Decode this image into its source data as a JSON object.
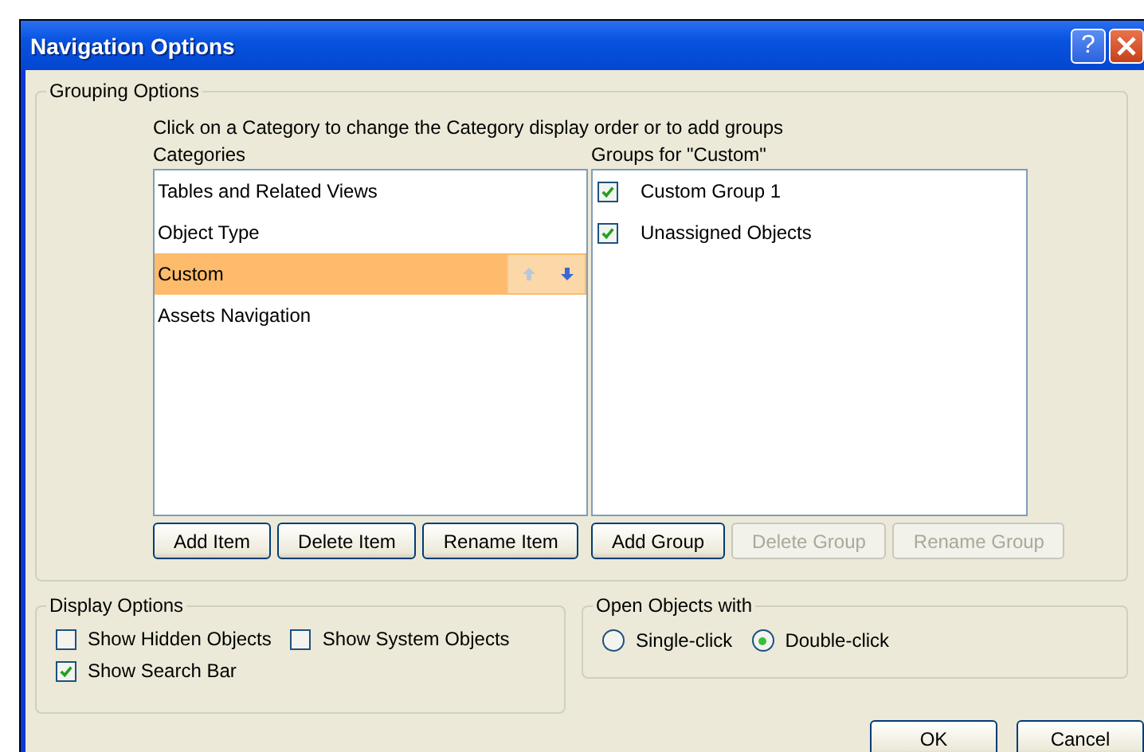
{
  "window": {
    "title": "Navigation Options",
    "help": "?"
  },
  "grouping_options": {
    "legend": "Grouping Options",
    "instruction": "Click on a Category to change the Category display order or to add groups",
    "categories_label": "Categories",
    "groups_label": "Groups for \"Custom\"",
    "categories": [
      {
        "label": "Tables and Related Views",
        "selected": false
      },
      {
        "label": "Object Type",
        "selected": false
      },
      {
        "label": "Custom",
        "selected": true
      },
      {
        "label": "Assets Navigation",
        "selected": false
      }
    ],
    "groups": [
      {
        "label": "Custom Group 1",
        "checked": true
      },
      {
        "label": "Unassigned Objects",
        "checked": true
      }
    ],
    "category_buttons": [
      {
        "label": "Add Item",
        "disabled": false
      },
      {
        "label": "Delete Item",
        "disabled": false
      },
      {
        "label": "Rename Item",
        "disabled": false
      }
    ],
    "group_buttons": [
      {
        "label": "Add Group",
        "disabled": false
      },
      {
        "label": "Delete Group",
        "disabled": true
      },
      {
        "label": "Rename Group",
        "disabled": true
      }
    ]
  },
  "display_options": {
    "legend": "Display Options",
    "options": [
      {
        "label": "Show Hidden Objects",
        "checked": false
      },
      {
        "label": "Show System Objects",
        "checked": false
      },
      {
        "label": "Show Search Bar",
        "checked": true
      }
    ]
  },
  "open_objects": {
    "legend": "Open Objects with",
    "options": [
      {
        "label": "Single-click",
        "selected": false
      },
      {
        "label": "Double-click",
        "selected": true
      }
    ]
  },
  "buttons": [
    "OK",
    "Cancel"
  ]
}
